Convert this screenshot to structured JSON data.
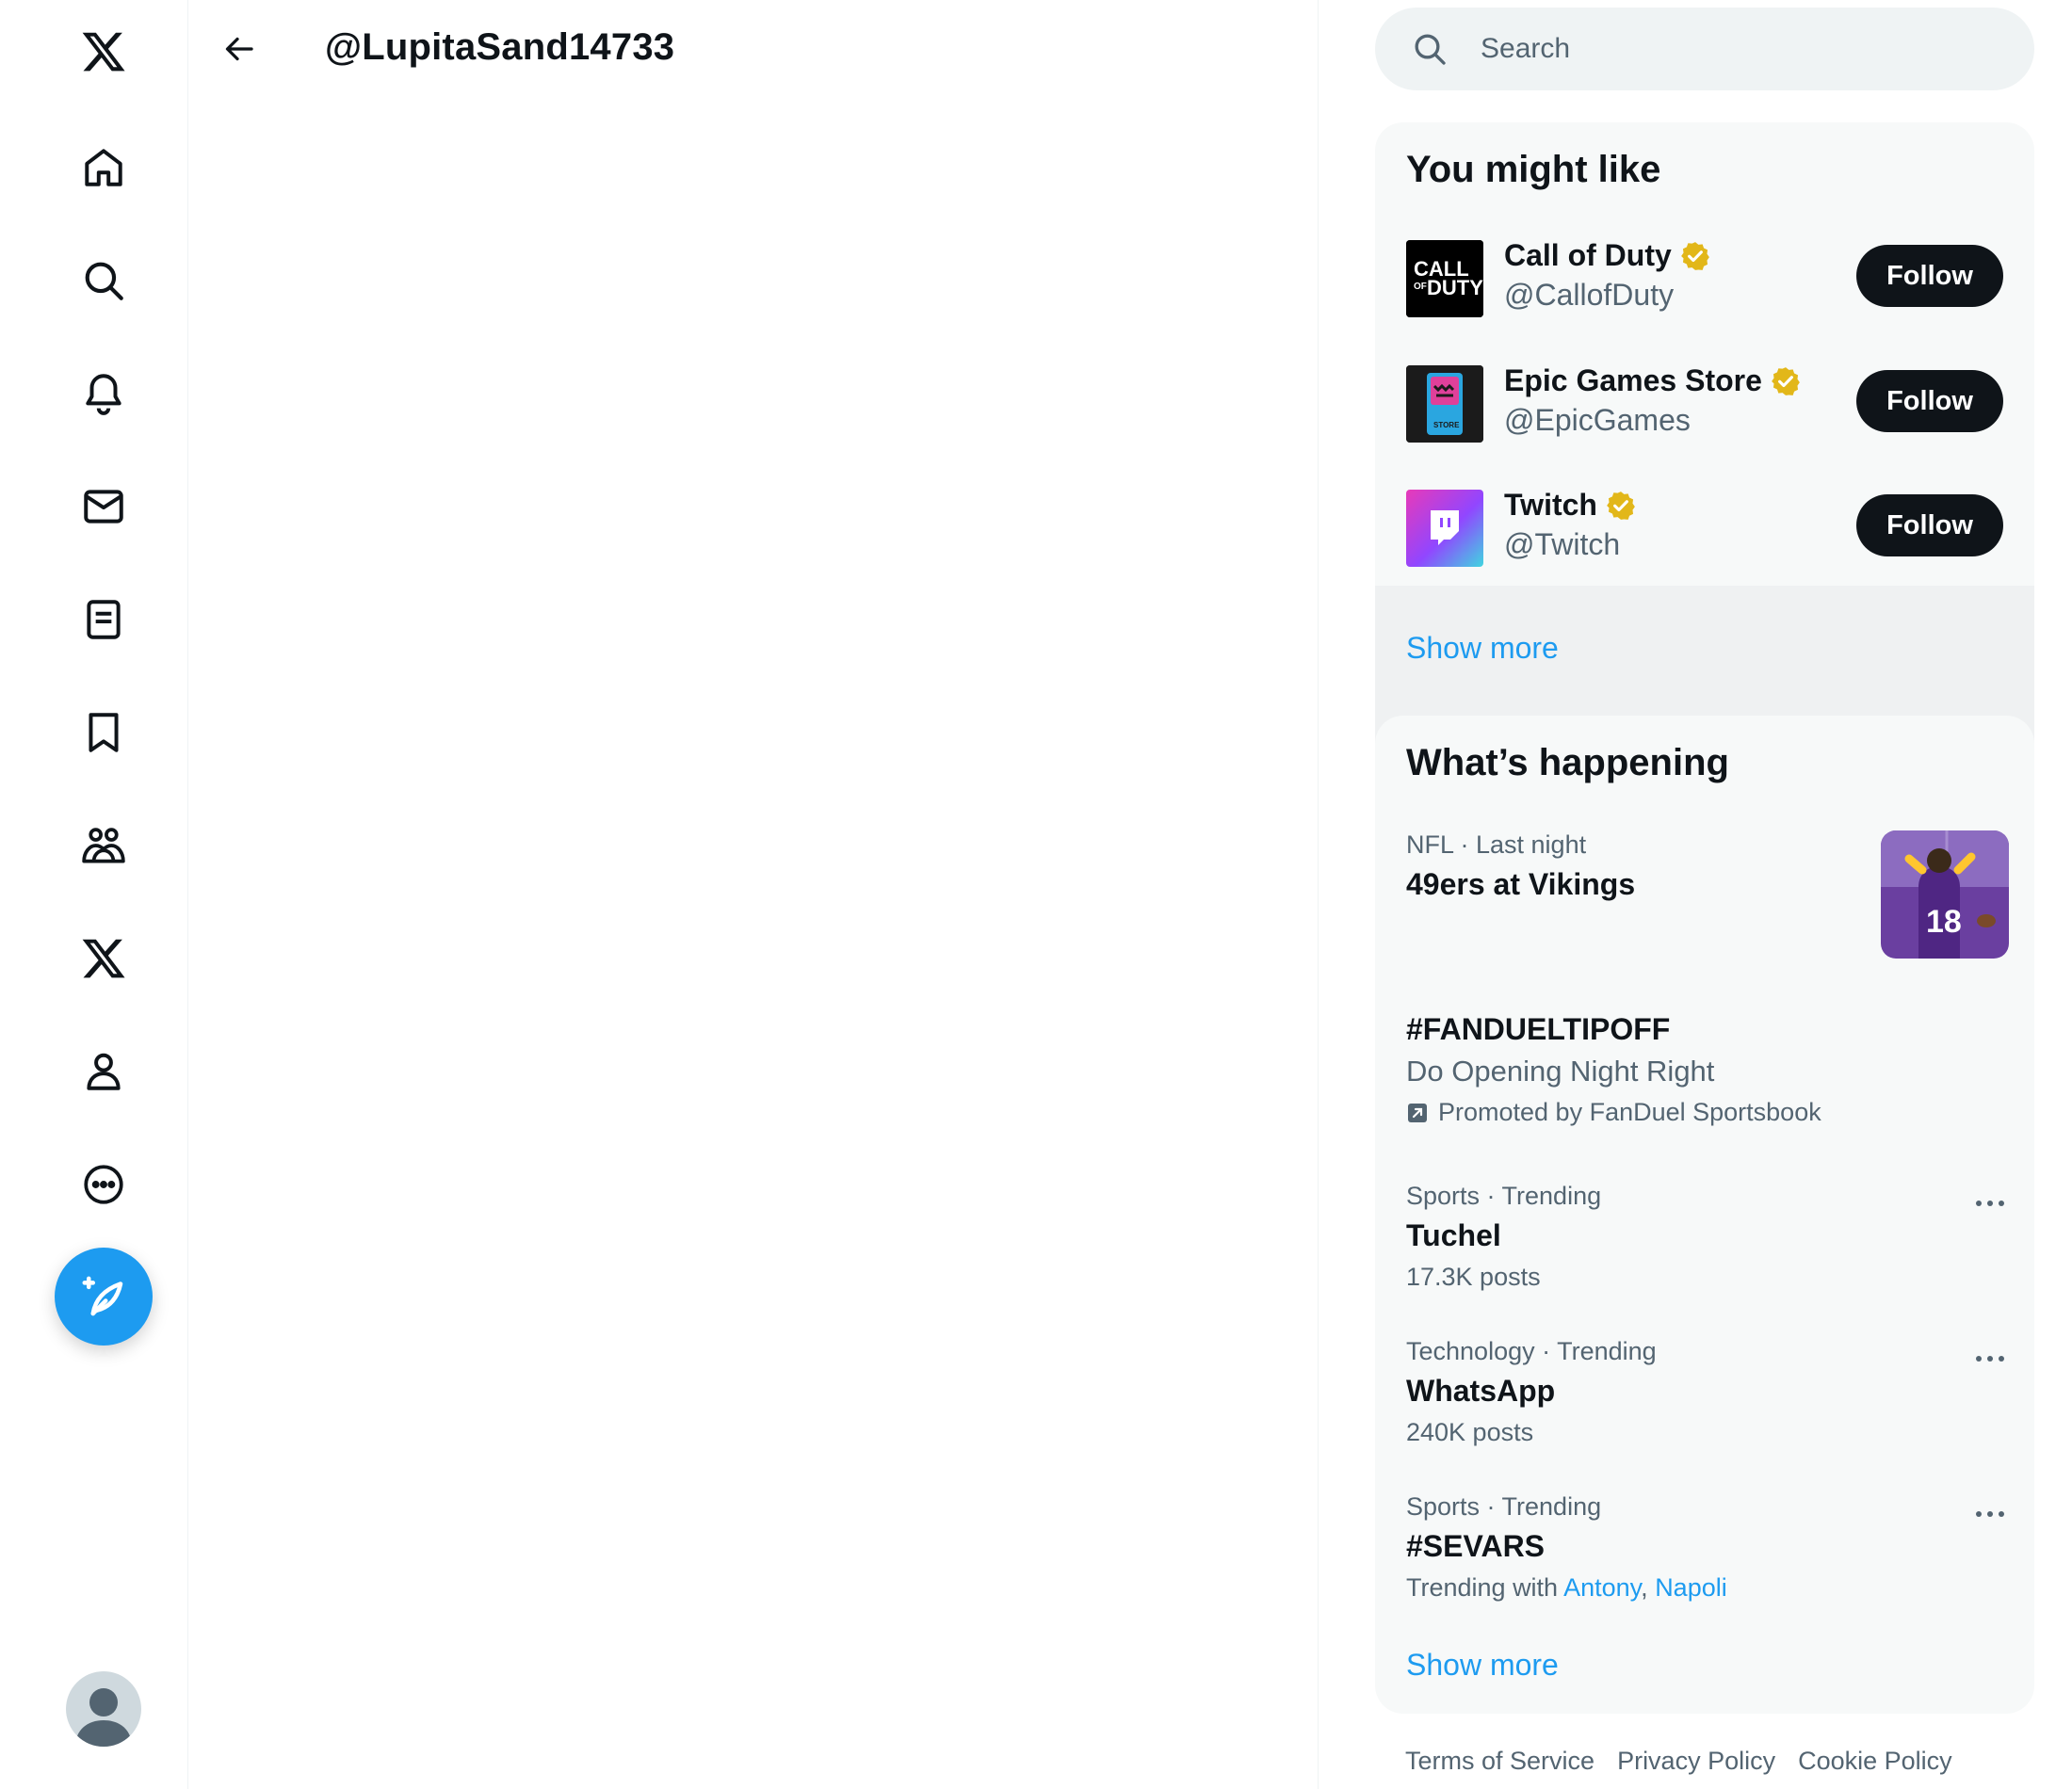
{
  "nav": {
    "items": [
      "x-logo",
      "home",
      "explore",
      "notifications",
      "messages",
      "lists",
      "bookmarks",
      "communities",
      "premium",
      "profile",
      "more"
    ]
  },
  "header": {
    "title": "@LupitaSand14733"
  },
  "search": {
    "placeholder": "Search"
  },
  "who_to_follow": {
    "title": "You might like",
    "accounts": [
      {
        "name": "Call of Duty",
        "handle": "@CallofDuty",
        "button": "Follow",
        "logo_text_1": "CALL",
        "logo_text_2": "OF",
        "logo_text_3": "DUTY"
      },
      {
        "name": "Epic Games Store",
        "handle": "@EpicGames",
        "button": "Follow",
        "logo_text": "STORE"
      },
      {
        "name": "Twitch",
        "handle": "@Twitch",
        "button": "Follow"
      }
    ],
    "show_more": "Show more"
  },
  "happening": {
    "title": "What’s happening",
    "trends": [
      {
        "meta": "NFL · Last night",
        "title": "49ers at Vikings",
        "jersey": "18"
      },
      {
        "title": "#FANDUELTIPOFF",
        "sub": "Do Opening Night Right",
        "promo": "Promoted by FanDuel Sportsbook"
      },
      {
        "meta": "Sports · Trending",
        "title": "Tuchel",
        "count": "17.3K posts"
      },
      {
        "meta": "Technology · Trending",
        "title": "WhatsApp",
        "count": "240K posts"
      },
      {
        "meta": "Sports · Trending",
        "title": "#SEVARS",
        "with_label": "Trending with",
        "with_1": "Antony",
        "sep": ",",
        "with_2": "Napoli"
      }
    ],
    "show_more": "Show more"
  },
  "footer": {
    "links": [
      "Terms of Service",
      "Privacy Policy",
      "Cookie Policy"
    ]
  },
  "colors": {
    "accent": "#1d9bf0",
    "text": "#0f1419",
    "muted": "#536471",
    "verified": "#e2b719",
    "panel_bg": "#f7f9f9"
  }
}
